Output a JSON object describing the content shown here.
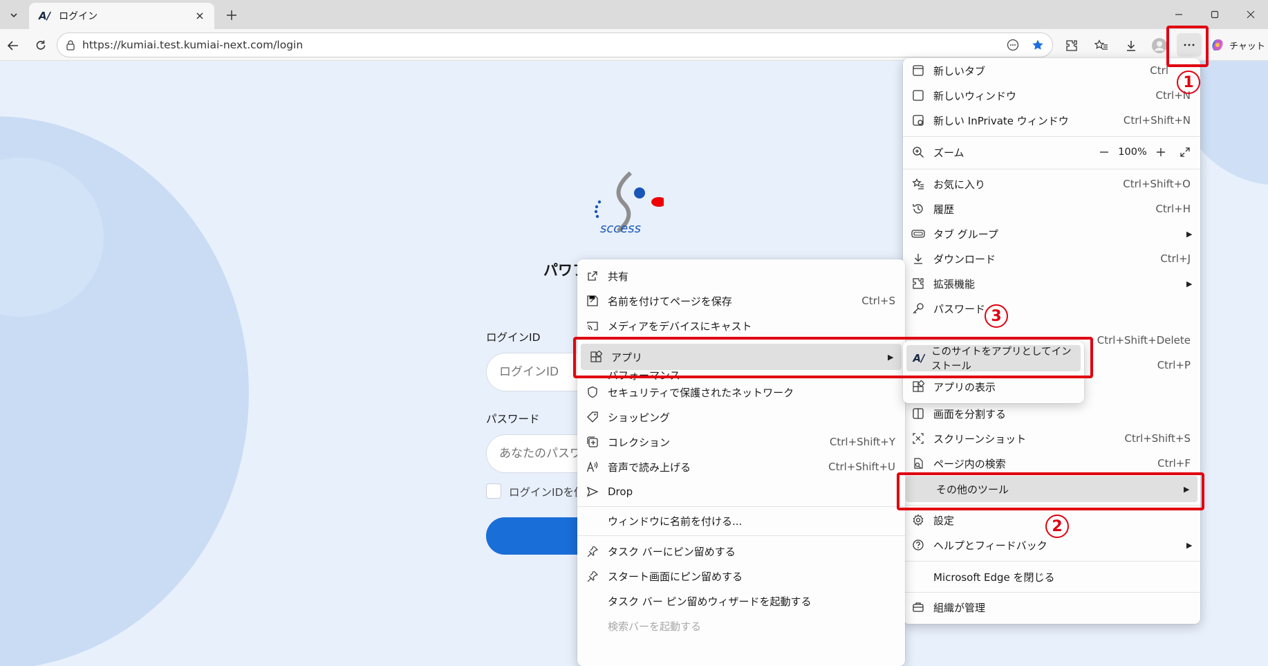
{
  "browser": {
    "tab_title": "ログイン",
    "url": "https://kumiai.test.kumiai-next.com/login",
    "chat_label": "チャット",
    "icons": [
      "tab-list-icon",
      "app-logo-icon",
      "close-icon",
      "new-tab-icon",
      "minimize-icon",
      "maximize-icon",
      "window-close-icon",
      "back-icon",
      "refresh-icon",
      "site-info-icon",
      "read-aloud-icon",
      "favorite-star-icon",
      "extensions-icon",
      "favorites-icon",
      "downloads-icon",
      "profile-icon",
      "more-icon",
      "copilot-icon"
    ]
  },
  "login": {
    "heading_partial": "パワフ",
    "id_label": "ログインID",
    "id_placeholder": "ログインID",
    "password_label": "パスワード",
    "password_placeholder": "あなたのパスワ",
    "remember_label": "ログインIDを使"
  },
  "main_menu": {
    "items": [
      {
        "icon": "new-tab-icon",
        "label": "新しいタブ",
        "shortcut": "Ctrl"
      },
      {
        "icon": "new-window-icon",
        "label": "新しいウィンドウ",
        "shortcut": "Ctrl+N"
      },
      {
        "icon": "inprivate-icon",
        "label": "新しい InPrivate ウィンドウ",
        "shortcut": "Ctrl+Shift+N"
      },
      {
        "icon": "zoom-icon",
        "label": "ズーム",
        "zoom_value": "100%"
      },
      {
        "icon": "favorites-icon",
        "label": "お気に入り",
        "shortcut": "Ctrl+Shift+O"
      },
      {
        "icon": "history-icon",
        "label": "履歴",
        "shortcut": "Ctrl+H"
      },
      {
        "icon": "tab-group-icon",
        "label": "タブ グループ",
        "arrow": "▶"
      },
      {
        "icon": "download-icon",
        "label": "ダウンロード",
        "shortcut": "Ctrl+J"
      },
      {
        "icon": "extensions-icon",
        "label": "拡張機能",
        "arrow": "▶"
      },
      {
        "icon": "password-key-icon",
        "label": "パスワード"
      },
      {
        "icon": "clear-data-icon",
        "label": "",
        "shortcut": "Ctrl+Shift+Delete"
      },
      {
        "icon": "print-icon",
        "label": "",
        "shortcut": "Ctrl+P"
      },
      {
        "icon": "split-screen-icon",
        "label": "画面を分割する"
      },
      {
        "icon": "screenshot-icon",
        "label": "スクリーンショット",
        "shortcut": "Ctrl+Shift+S"
      },
      {
        "icon": "find-icon",
        "label": "ページ内の検索",
        "shortcut": "Ctrl+F"
      },
      {
        "icon": "more-tools-icon",
        "label": "その他のツール",
        "arrow": "▶"
      },
      {
        "icon": "settings-icon",
        "label": "設定"
      },
      {
        "icon": "help-icon",
        "label": "ヘルプとフィードバック",
        "arrow": "▶"
      },
      {
        "icon": "",
        "label": "Microsoft Edge を閉じる"
      },
      {
        "icon": "organization-icon",
        "label": "組織が管理"
      }
    ]
  },
  "tools_menu": {
    "items": [
      {
        "icon": "share-icon",
        "label": "共有",
        "shortcut": ""
      },
      {
        "icon": "save-page-icon",
        "label": "名前を付けてページを保存",
        "shortcut": "Ctrl+S"
      },
      {
        "icon": "cast-icon",
        "label": "メディアをデバイスにキャスト",
        "shortcut": ""
      },
      {
        "icon": "apps-icon",
        "label": "アプリ",
        "arrow": "▶"
      },
      {
        "icon": "performance-icon",
        "label": "パフォーマンス",
        "shortcut": ""
      },
      {
        "icon": "shield-icon",
        "label": "セキュリティで保護されたネットワーク",
        "shortcut": ""
      },
      {
        "icon": "shopping-tag-icon",
        "label": "ショッピング",
        "shortcut": ""
      },
      {
        "icon": "collections-icon",
        "label": "コレクション",
        "shortcut": "Ctrl+Shift+Y"
      },
      {
        "icon": "read-aloud-icon",
        "label": "音声で読み上げる",
        "shortcut": "Ctrl+Shift+U"
      },
      {
        "icon": "drop-send-icon",
        "label": "Drop",
        "shortcut": ""
      },
      {
        "icon": "",
        "label": "ウィンドウに名前を付ける...",
        "shortcut": ""
      },
      {
        "icon": "pin-icon",
        "label": "タスク バーにピン留めする",
        "shortcut": ""
      },
      {
        "icon": "pin-icon",
        "label": "スタート画面にピン留めする",
        "shortcut": ""
      },
      {
        "icon": "",
        "label": "タスク バー ピン留めウィザードを起動する",
        "shortcut": ""
      },
      {
        "icon": "",
        "label": "検索バーを起動する",
        "shortcut": "",
        "disabled": true
      }
    ]
  },
  "apps_menu": {
    "items": [
      {
        "icon": "app-logo-icon",
        "label": "このサイトをアプリとしてインストール"
      },
      {
        "icon": "apps-icon",
        "label": "アプリの表示"
      }
    ]
  },
  "annotations": {
    "step1": "1",
    "step2": "2",
    "step3": "3",
    "color": "#e00010"
  }
}
